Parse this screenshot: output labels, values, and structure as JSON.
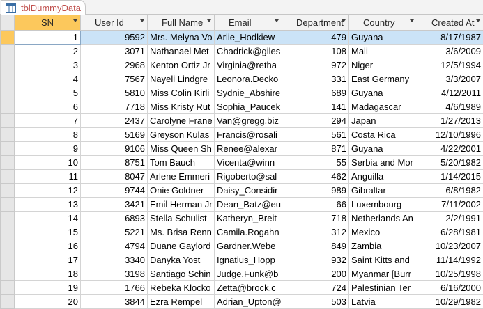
{
  "tab": {
    "label": "tblDummyData",
    "icon": "table-icon"
  },
  "columns": [
    "SN",
    "User Id",
    "Full Name",
    "Email",
    "Department",
    "Country",
    "Created At"
  ],
  "rows": [
    [
      "1",
      "9592",
      "Mrs. Melyna Vo",
      "Arlie_Hodkiew",
      "479",
      "Guyana",
      "8/17/1987"
    ],
    [
      "2",
      "3071",
      "Nathanael Met",
      "Chadrick@giles",
      "108",
      "Mali",
      "3/6/2009"
    ],
    [
      "3",
      "2968",
      "Kenton Ortiz Jr",
      "Virginia@retha",
      "972",
      "Niger",
      "12/5/1994"
    ],
    [
      "4",
      "7567",
      "Nayeli Lindgre",
      "Leonora.Decko",
      "331",
      "East Germany",
      "3/3/2007"
    ],
    [
      "5",
      "5810",
      "Miss Colin Kirli",
      "Sydnie_Abshire",
      "689",
      "Guyana",
      "4/12/2011"
    ],
    [
      "6",
      "7718",
      "Miss Kristy Rut",
      "Sophia_Paucek",
      "141",
      "Madagascar",
      "4/6/1989"
    ],
    [
      "7",
      "2437",
      "Carolyne Frane",
      "Van@gregg.biz",
      "294",
      "Japan",
      "1/27/2013"
    ],
    [
      "8",
      "5169",
      "Greyson Kulas",
      "Francis@rosali",
      "561",
      "Costa Rica",
      "12/10/1996"
    ],
    [
      "9",
      "9106",
      "Miss Queen Sh",
      "Renee@alexar",
      "871",
      "Guyana",
      "4/22/2001"
    ],
    [
      "10",
      "8751",
      "Tom Bauch",
      "Vicenta@winn",
      "55",
      "Serbia and Mor",
      "5/20/1982"
    ],
    [
      "11",
      "8047",
      "Arlene Emmeri",
      "Rigoberto@sal",
      "462",
      "Anguilla",
      "1/14/2015"
    ],
    [
      "12",
      "9744",
      "Onie Goldner",
      "Daisy_Considir",
      "989",
      "Gibraltar",
      "6/8/1982"
    ],
    [
      "13",
      "3421",
      "Emil Herman Jr",
      "Dean_Batz@eu",
      "66",
      "Luxembourg",
      "7/11/2002"
    ],
    [
      "14",
      "6893",
      "Stella Schulist",
      "Katheryn_Breit",
      "718",
      "Netherlands An",
      "2/2/1991"
    ],
    [
      "15",
      "5221",
      "Ms. Brisa Renn",
      "Camila.Rogahn",
      "312",
      "Mexico",
      "6/28/1981"
    ],
    [
      "16",
      "4794",
      "Duane Gaylord",
      "Gardner.Webe",
      "849",
      "Zambia",
      "10/23/2007"
    ],
    [
      "17",
      "3340",
      "Danyka Yost",
      "Ignatius_Hopp",
      "932",
      "Saint Kitts and",
      "11/14/1992"
    ],
    [
      "18",
      "3198",
      "Santiago Schin",
      "Judge.Funk@b",
      "200",
      "Myanmar [Burr",
      "10/25/1998"
    ],
    [
      "19",
      "1766",
      "Rebeka Klocko",
      "Zetta@brock.c",
      "724",
      "Palestinian Ter",
      "6/16/2000"
    ],
    [
      "20",
      "3844",
      "Ezra Rempel",
      "Adrian_Upton@",
      "503",
      "Latvia",
      "10/29/1982"
    ]
  ],
  "colors": {
    "tab_text": "#c0504d",
    "selected_column_header": "#fcc85c",
    "active_row": "#cbe3f7",
    "header_bg": "#f3f3f3"
  }
}
